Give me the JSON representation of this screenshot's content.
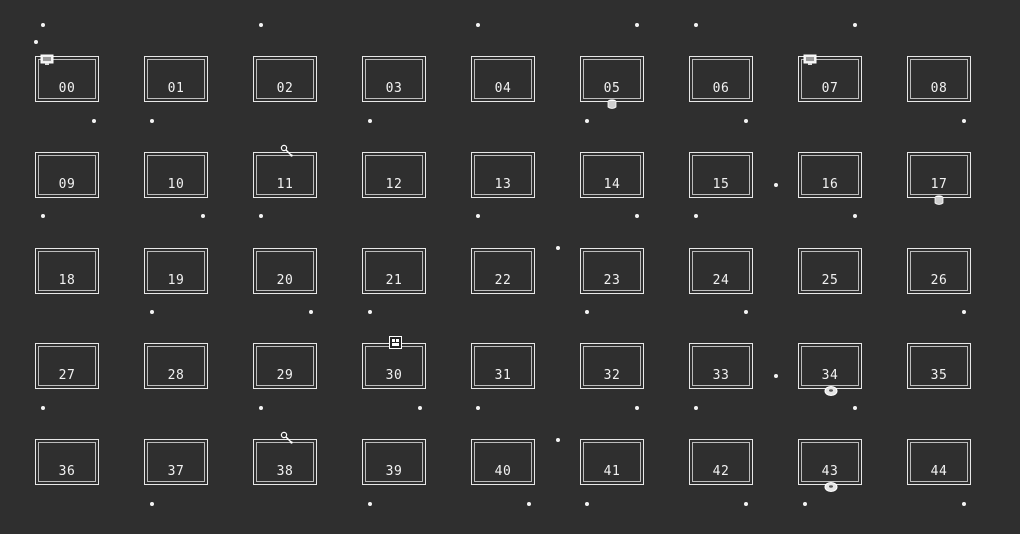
{
  "rooms": [
    {
      "label": "00",
      "item": "monitor-icon",
      "item_pos": "top-left"
    },
    {
      "label": "01"
    },
    {
      "label": "02"
    },
    {
      "label": "03"
    },
    {
      "label": "04"
    },
    {
      "label": "05",
      "item": "cup-icon",
      "item_pos": "bottom"
    },
    {
      "label": "06"
    },
    {
      "label": "07",
      "item": "monitor-icon",
      "item_pos": "top-left"
    },
    {
      "label": "08"
    },
    {
      "label": "09"
    },
    {
      "label": "10"
    },
    {
      "label": "11",
      "item": "drumstick-icon",
      "item_pos": "top"
    },
    {
      "label": "12"
    },
    {
      "label": "13"
    },
    {
      "label": "14"
    },
    {
      "label": "15"
    },
    {
      "label": "16"
    },
    {
      "label": "17",
      "item": "cup-icon",
      "item_pos": "bottom"
    },
    {
      "label": "18"
    },
    {
      "label": "19"
    },
    {
      "label": "20"
    },
    {
      "label": "21"
    },
    {
      "label": "22"
    },
    {
      "label": "23"
    },
    {
      "label": "24"
    },
    {
      "label": "25"
    },
    {
      "label": "26"
    },
    {
      "label": "27"
    },
    {
      "label": "28"
    },
    {
      "label": "29"
    },
    {
      "label": "30",
      "item": "framed-picture-icon",
      "item_pos": "top"
    },
    {
      "label": "31"
    },
    {
      "label": "32"
    },
    {
      "label": "33"
    },
    {
      "label": "34",
      "item": "donut-icon",
      "item_pos": "bottom"
    },
    {
      "label": "35"
    },
    {
      "label": "36"
    },
    {
      "label": "37"
    },
    {
      "label": "38",
      "item": "drumstick-icon",
      "item_pos": "top"
    },
    {
      "label": "39"
    },
    {
      "label": "40"
    },
    {
      "label": "41"
    },
    {
      "label": "42"
    },
    {
      "label": "43",
      "item": "donut-icon",
      "item_pos": "bottom"
    },
    {
      "label": "44"
    }
  ],
  "colors": {
    "background": "#2f2f2f",
    "wall": "#e8e8e8",
    "text": "#f2f2f2",
    "dot": "#f4f4f4"
  }
}
